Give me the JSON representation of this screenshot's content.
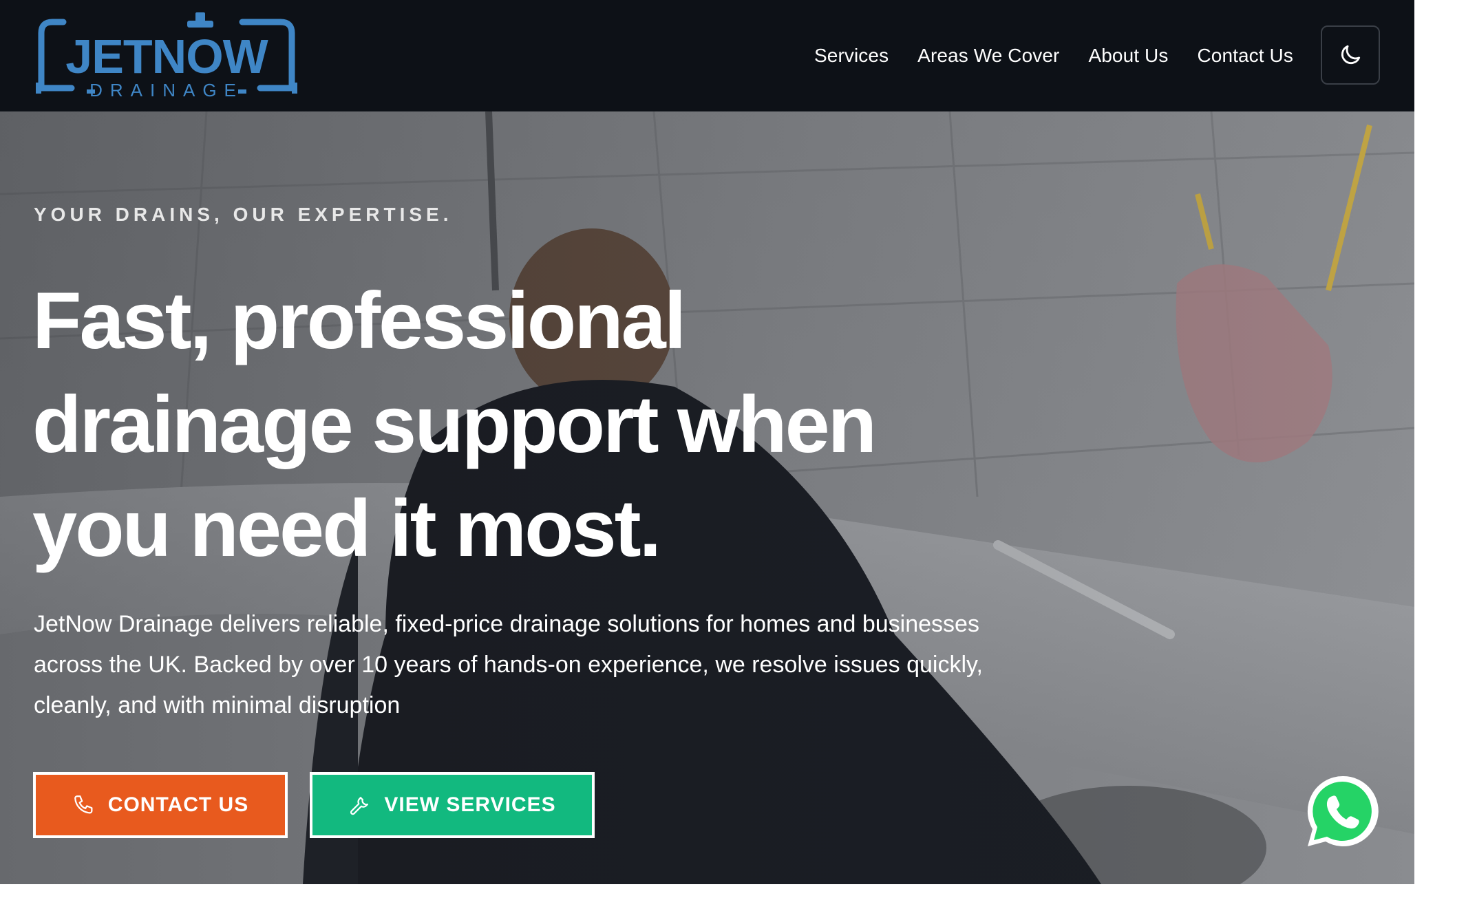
{
  "colors": {
    "header_bg": "#0d1117",
    "brand_blue": "#3f86c6",
    "contact_button": "#e85a1e",
    "services_button": "#12b97f",
    "whatsapp_green": "#25d366"
  },
  "header": {
    "logo": {
      "brand": "JETNOW",
      "sub": "DRAINAGE",
      "icon": "tap-pipe-logo"
    },
    "nav": [
      {
        "label": "Services"
      },
      {
        "label": "Areas We Cover"
      },
      {
        "label": "About Us"
      },
      {
        "label": "Contact Us"
      }
    ],
    "theme_toggle_icon": "moon-icon"
  },
  "hero": {
    "tagline": "YOUR DRAINS, OUR EXPERTISE.",
    "headline": "Fast, professional drainage support when you need it most.",
    "description": "JetNow Drainage delivers reliable, fixed-price drainage solutions for homes and businesses across the UK. Backed by over 10 years of hands-on experience, we resolve issues quickly, cleanly, and with minimal disruption",
    "buttons": {
      "contact": {
        "label": "CONTACT US",
        "icon": "phone-icon"
      },
      "services": {
        "label": "VIEW SERVICES",
        "icon": "wrench-icon"
      }
    },
    "background_image": "technician-unblocking-bath-drain",
    "floating_icon": "whatsapp-icon"
  }
}
